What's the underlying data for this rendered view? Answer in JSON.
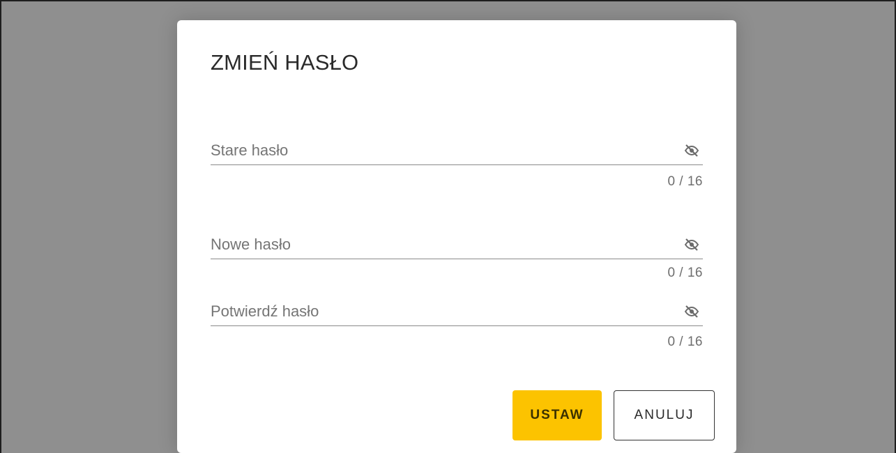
{
  "dialog": {
    "title": "ZMIEŃ HASŁO",
    "fields": [
      {
        "placeholder": "Stare hasło",
        "value": "",
        "counter": "0 / 16",
        "icon": "eye-off-icon"
      },
      {
        "placeholder": "Nowe hasło",
        "value": "",
        "counter": "0 / 16",
        "icon": "eye-off-icon"
      },
      {
        "placeholder": "Potwierdź hasło",
        "value": "",
        "counter": "0 / 16",
        "icon": "eye-off-icon"
      }
    ],
    "buttons": {
      "set_label": "USTAW",
      "cancel_label": "ANULUJ"
    }
  },
  "colors": {
    "overlay": "#8f8f8f",
    "primary_button": "#fcc300"
  }
}
